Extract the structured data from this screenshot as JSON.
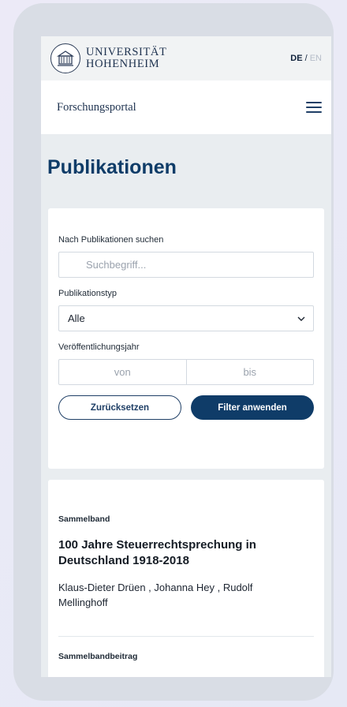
{
  "header": {
    "university_line1": "UNIVERSITÄT",
    "university_line2": "HOHENHEIM",
    "lang_active": "DE",
    "lang_separator": " / ",
    "lang_inactive": "EN"
  },
  "nav": {
    "portal_name": "Forschungsportal",
    "menu_icon": "hamburger-menu-icon"
  },
  "page": {
    "title": "Publikationen"
  },
  "filters": {
    "search_label": "Nach Publikationen suchen",
    "search_placeholder": "Suchbegriff...",
    "type_label": "Publikationstyp",
    "type_selected": "Alle",
    "year_label": "Veröffentlichungsjahr",
    "year_from_placeholder": "von",
    "year_to_placeholder": "bis",
    "reset_label": "Zurücksetzen",
    "apply_label": "Filter anwenden"
  },
  "results": [
    {
      "type": "Sammelband",
      "title": "100 Jahre Steuerrechtsprechung in Deutschland 1918-2018",
      "authors": "Klaus-Dieter Drüen ,  Johanna Hey ,  Rudolf Mellinghoff"
    },
    {
      "type": "Sammelbandbeitrag"
    }
  ],
  "colors": {
    "primary": "#0f3c68",
    "background": "#e9edf0",
    "card": "#ffffff"
  }
}
